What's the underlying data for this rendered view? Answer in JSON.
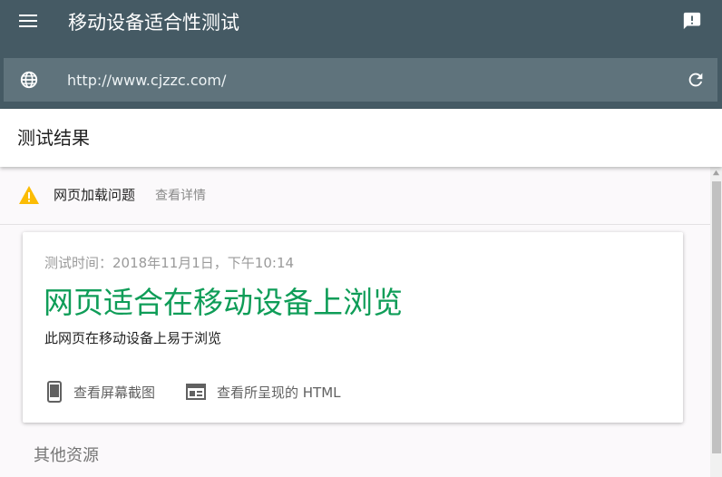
{
  "app": {
    "title": "移动设备适合性测试",
    "menu_icon": "hamburger-menu-icon",
    "feedback_icon": "feedback-icon"
  },
  "urlbar": {
    "url": "http://www.cjzzc.com/",
    "globe_icon": "globe-icon",
    "refresh_icon": "refresh-icon"
  },
  "results": {
    "title": "测试结果"
  },
  "warning": {
    "text": "网页加载问题",
    "details_link": "查看详情",
    "color": "#fbbc05"
  },
  "card": {
    "test_time": "测试时间：2018年11月1日，下午10:14",
    "verdict": "网页适合在移动设备上浏览",
    "verdict_color": "#0f9d58",
    "subtext": "此网页在移动设备上易于浏览",
    "actions": [
      {
        "label": "查看屏幕截图",
        "icon": "phone-icon"
      },
      {
        "label": "查看所呈现的 HTML",
        "icon": "web-page-icon"
      }
    ]
  },
  "other_resources": {
    "title": "其他资源"
  },
  "colors": {
    "topbar": "#455a64",
    "urlbar": "#5f737c"
  }
}
